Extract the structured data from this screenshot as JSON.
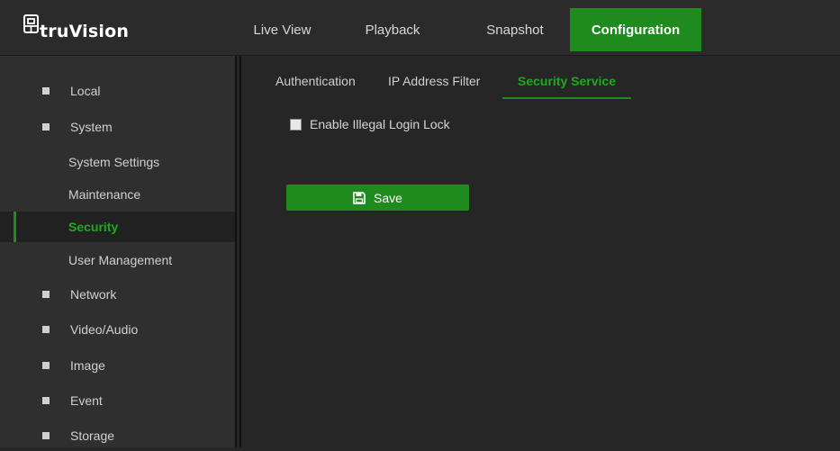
{
  "brand": {
    "logo_text": "truVision"
  },
  "nav": {
    "live_view": "Live View",
    "playback": "Playback",
    "snapshot": "Snapshot",
    "configuration": "Configuration"
  },
  "sidebar": {
    "items": [
      {
        "label": "Local",
        "type": "group"
      },
      {
        "label": "System",
        "type": "group"
      },
      {
        "label": "System Settings",
        "type": "sub"
      },
      {
        "label": "Maintenance",
        "type": "sub"
      },
      {
        "label": "Security",
        "type": "sub",
        "active": true
      },
      {
        "label": "User Management",
        "type": "sub"
      },
      {
        "label": "Network",
        "type": "group"
      },
      {
        "label": "Video/Audio",
        "type": "group"
      },
      {
        "label": "Image",
        "type": "group"
      },
      {
        "label": "Event",
        "type": "group"
      },
      {
        "label": "Storage",
        "type": "group"
      }
    ]
  },
  "tabs": {
    "authentication": "Authentication",
    "ip_address_filter": "IP Address Filter",
    "security_service": "Security Service"
  },
  "form": {
    "illegal_login_lock_label": "Enable Illegal Login Lock",
    "illegal_login_lock_checked": false,
    "save_label": "Save"
  },
  "colors": {
    "accent": "#1f8b1f",
    "accent_text": "#1fa91f",
    "background": "#262626",
    "sidebar": "#2f2f2f"
  },
  "icons": {
    "logo": "network-logo-icon",
    "save": "floppy-disk-icon",
    "bullet": "square-bullet-icon"
  }
}
